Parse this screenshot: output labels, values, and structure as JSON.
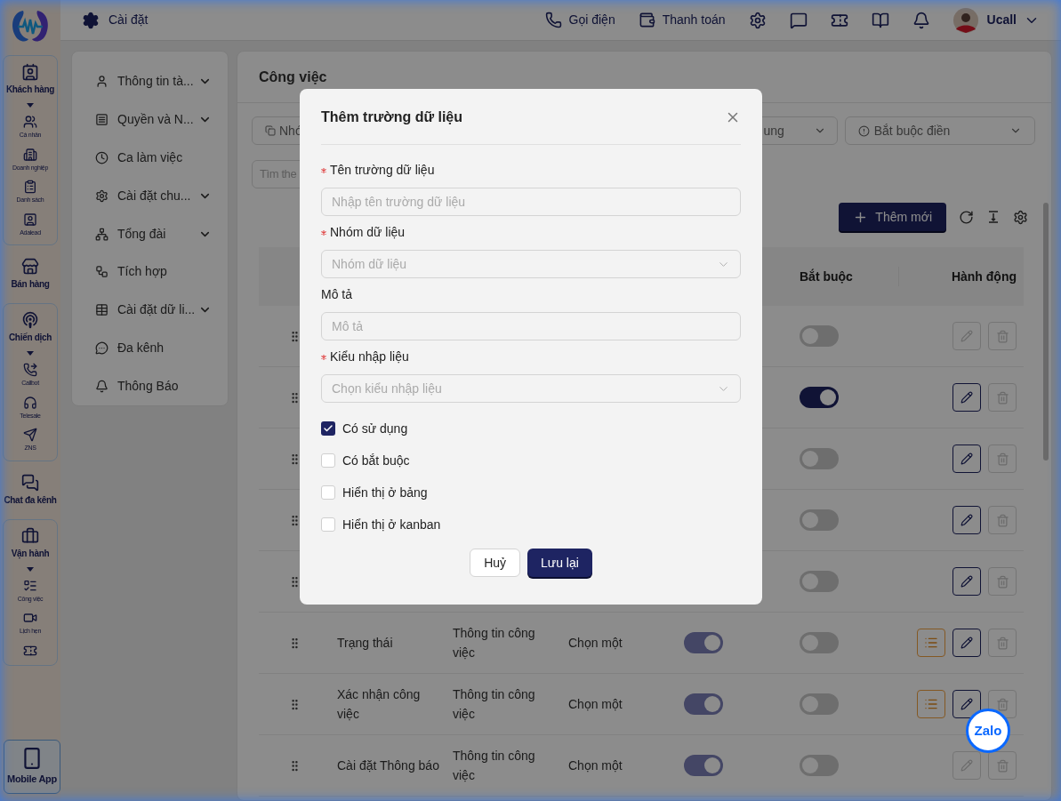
{
  "rail": [
    {
      "kind": "group",
      "label": "Khách hàng",
      "expanded": true,
      "children": [
        {
          "label": "Cá nhân"
        },
        {
          "label": "Doanh nghiệp"
        },
        {
          "label": "Danh sách"
        },
        {
          "label": "Adalead"
        }
      ]
    },
    {
      "kind": "item",
      "label": "Bán hàng"
    },
    {
      "kind": "group",
      "label": "Chiến dịch",
      "expanded": true,
      "children": [
        {
          "label": "Callbot"
        },
        {
          "label": "Telesale"
        },
        {
          "label": "ZNS"
        }
      ]
    },
    {
      "kind": "item",
      "label": "Chat đa kênh"
    },
    {
      "kind": "group",
      "label": "Vận hành",
      "expanded": true,
      "children": [
        {
          "label": "Công việc"
        },
        {
          "label": "Lịch hẹn"
        },
        {
          "kind": "icon_only"
        }
      ]
    }
  ],
  "mobile_app": "Mobile App",
  "topbar": {
    "title": "Cài đặt",
    "actions": [
      "Gọi điện",
      "Thanh toán"
    ],
    "user": "Ucall"
  },
  "settings_menu": [
    {
      "label": "Thông tin tà...",
      "expandable": true
    },
    {
      "label": "Quyền và N...",
      "expandable": true
    },
    {
      "label": "Ca làm việc",
      "expandable": false
    },
    {
      "label": "Cài đặt chu...",
      "expandable": true
    },
    {
      "label": "Tổng đài",
      "expandable": true
    },
    {
      "label": "Tích hợp",
      "expandable": false
    },
    {
      "label": "Cài đặt dữ li...",
      "expandable": true
    },
    {
      "label": "Đa kênh",
      "expandable": false
    },
    {
      "label": "Thông Báo",
      "expandable": false
    }
  ],
  "main": {
    "title": "Công việc",
    "filters": [
      "Nhó",
      "ung",
      "Bắt buộc điền"
    ],
    "search": "Tìm the",
    "add_button": "Thêm mới",
    "columns": {
      "required": "Bắt buộc",
      "actions": "Hành động"
    },
    "rows": [
      {
        "required": false,
        "edit_enabled": false,
        "has_options": false
      },
      {
        "required": true,
        "edit_enabled": true,
        "has_options": false
      },
      {
        "required": false,
        "edit_enabled": true,
        "has_options": false
      },
      {
        "required": false,
        "edit_enabled": true,
        "has_options": false
      },
      {
        "required": false,
        "edit_enabled": true,
        "has_options": false
      },
      {
        "name": "Trạng thái",
        "group": "Thông tin công việc",
        "type": "Chọn một",
        "used": true,
        "required": false,
        "edit_enabled": true,
        "has_options": true
      },
      {
        "name": "Xác nhận công việc",
        "group": "Thông tin công việc",
        "type": "Chọn một",
        "used": true,
        "required": false,
        "edit_enabled": true,
        "has_options": true
      },
      {
        "name": "Cài đặt Thông báo",
        "group": "Thông tin công việc",
        "type": "Chọn một",
        "used": true,
        "required": false,
        "edit_enabled": false,
        "has_options": false
      }
    ]
  },
  "dialog": {
    "title": "Thêm trường dữ liệu",
    "fields": [
      {
        "kind": "input",
        "label": "Tên trường dữ liệu",
        "required": true,
        "placeholder": "Nhập tên trường dữ liệu"
      },
      {
        "kind": "select",
        "label": "Nhóm dữ liệu",
        "required": true,
        "placeholder": "Nhóm dữ liệu"
      },
      {
        "kind": "input",
        "label": "Mô tả",
        "required": false,
        "placeholder": "Mô tả"
      },
      {
        "kind": "select",
        "label": "Kiểu nhập liệu",
        "required": true,
        "placeholder": "Chọn kiểu nhập liệu"
      }
    ],
    "checkboxes": [
      {
        "label": "Có sử dụng",
        "checked": true
      },
      {
        "label": "Có bắt buộc",
        "checked": false
      },
      {
        "label": "Hiển thị ở bảng",
        "checked": false
      },
      {
        "label": "Hiển thị ở kanban",
        "checked": false
      }
    ],
    "buttons": {
      "cancel": "Huỷ",
      "save": "Lưu lại"
    }
  },
  "chat_bubble": "Zalo"
}
